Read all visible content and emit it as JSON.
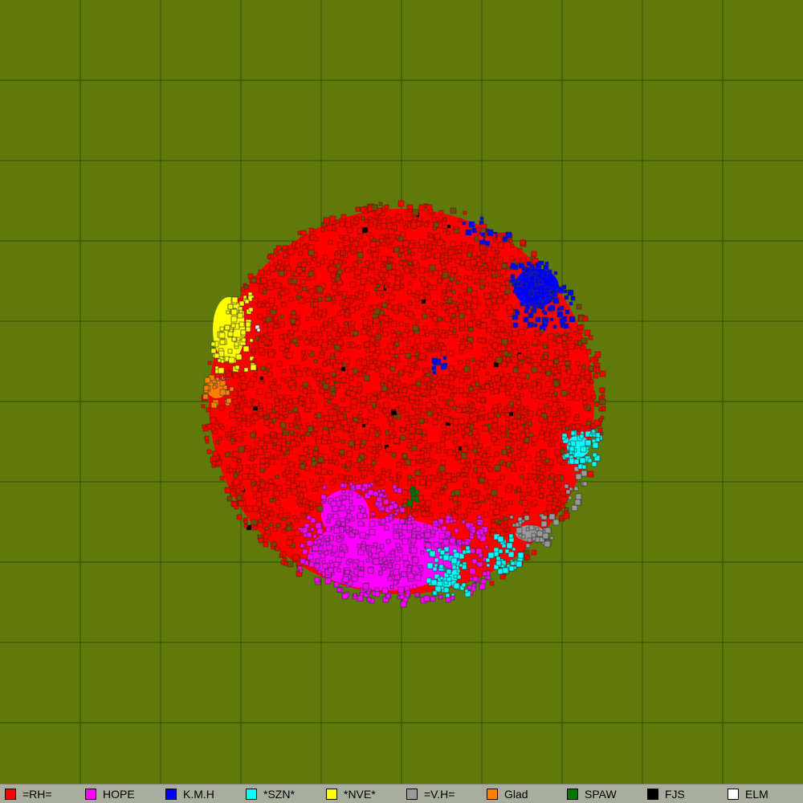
{
  "map": {
    "background_color": "#5f7a0b",
    "grid_color": "#2f4a05",
    "cell_outline_color": "#5a2000"
  },
  "legend": {
    "items": [
      {
        "label": "=RH=",
        "color": "#ff0000"
      },
      {
        "label": "HOPE",
        "color": "#ff00ff"
      },
      {
        "label": "K.M.H",
        "color": "#0000ff"
      },
      {
        "label": "*SZN*",
        "color": "#00ffff"
      },
      {
        "label": "*NVE*",
        "color": "#ffff00"
      },
      {
        "label": "=V.H=",
        "color": "#999999"
      },
      {
        "label": "Glad",
        "color": "#ff8000"
      },
      {
        "label": "SPAW",
        "color": "#007700"
      },
      {
        "label": "FJS",
        "color": "#000000"
      },
      {
        "label": "ELM",
        "color": "#ffffff"
      }
    ]
  }
}
